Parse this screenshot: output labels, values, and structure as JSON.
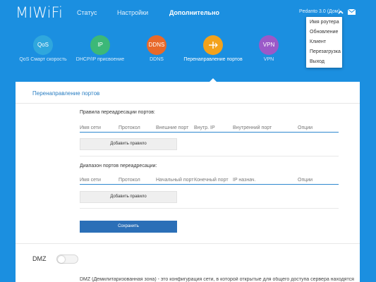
{
  "header": {
    "logo": "MIWiFi",
    "nav": [
      "Статус",
      "Настройки",
      "Дополнительно"
    ],
    "user": "Pedanto 3.0 (Дом)"
  },
  "user_menu": {
    "items": [
      "Имя роутера",
      "Обновление",
      "Клиент",
      "Перезагрузка",
      "Выход"
    ]
  },
  "features": [
    {
      "icon_text": "QoS",
      "label": "QoS Смарт скорость",
      "color": "#2fa7dd"
    },
    {
      "icon_text": "IP",
      "label": "DHCP/IP присвоение",
      "color": "#3cb878"
    },
    {
      "icon_text": "DDNS",
      "label": "DDNS",
      "color": "#e8692a"
    },
    {
      "icon_text": "",
      "label": "Перенаправление портов",
      "color": "#f3a21b"
    },
    {
      "icon_text": "VPN",
      "label": "VPN",
      "color": "#9b59c8"
    }
  ],
  "panel": {
    "title": "Перенаправление портов",
    "rules_title": "Правила переадресации портов:",
    "rules_headers": [
      "Имя сети",
      "Протокол",
      "Внешние порт",
      "Внутр. IP",
      "Внутренний порт",
      "Опции"
    ],
    "add_rule_label": "Добавить правило",
    "range_title": "Диапазон портов переадресации:",
    "range_headers": [
      "Имя сети",
      "Протокол",
      "Начальный порт",
      "Конечный порт",
      "IP назнач.",
      "Опции"
    ],
    "add_range_label": "Добавить правило",
    "save_label": "Сохранить",
    "dmz_label": "DMZ",
    "dmz_desc": "DMZ (Демилитаризованная зона) - это конфигурация сети, в которой открытые для общего доступа сервера находятся в"
  }
}
